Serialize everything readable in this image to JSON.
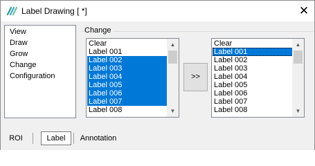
{
  "window": {
    "title": "Label Drawing [ *]",
    "icon": "app-logo-icon",
    "close_glyph": "✕"
  },
  "nav": {
    "items": [
      "View",
      "Draw",
      "Grow",
      "Change",
      "Configuration"
    ]
  },
  "change_group": {
    "label": "Change",
    "move_button_label": ">>"
  },
  "left_list": {
    "items": [
      {
        "text": "Clear",
        "selected": false
      },
      {
        "text": "Label 001",
        "selected": false
      },
      {
        "text": "Label 002",
        "selected": true
      },
      {
        "text": "Label 003",
        "selected": true
      },
      {
        "text": "Label 004",
        "selected": true
      },
      {
        "text": "Label 005",
        "selected": true
      },
      {
        "text": "Label 006",
        "selected": true
      },
      {
        "text": "Label 007",
        "selected": true
      },
      {
        "text": "Label 008",
        "selected": false
      }
    ]
  },
  "right_list": {
    "items": [
      {
        "text": "Clear",
        "selected": false
      },
      {
        "text": "Label 001",
        "selected": true
      },
      {
        "text": "Label 002",
        "selected": false
      },
      {
        "text": "Label 003",
        "selected": false
      },
      {
        "text": "Label 004",
        "selected": false
      },
      {
        "text": "Label 005",
        "selected": false
      },
      {
        "text": "Label 006",
        "selected": false
      },
      {
        "text": "Label 007",
        "selected": false
      },
      {
        "text": "Label 008",
        "selected": false
      }
    ]
  },
  "tabs": [
    {
      "label": "ROI",
      "active": false
    },
    {
      "label": "Label",
      "active": true
    },
    {
      "label": "Annotation",
      "active": false
    }
  ],
  "colors": {
    "selection": "#0078d7",
    "window_bg": "#f0f0f0",
    "list_bg": "#ffffff"
  }
}
